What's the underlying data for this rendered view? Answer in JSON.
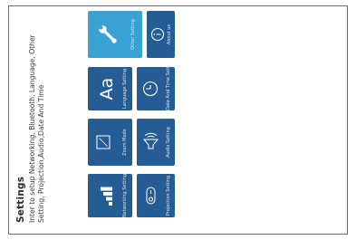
{
  "header": {
    "title": "Settings",
    "description_line1": "Inter to setup Networking, Bluetooth, Language, Other",
    "description_line2": "Setting, Projection,Audio,Date And Time"
  },
  "tiles": [
    {
      "label": "Networking Setting",
      "icon": "signal-bars-icon",
      "active": false
    },
    {
      "label": "Zoom Mode",
      "icon": "zoom-frame-icon",
      "active": false
    },
    {
      "label": "Language Setting",
      "icon": "language-aa-icon",
      "active": false
    },
    {
      "label": "Other Setting",
      "icon": "wrench-icon",
      "active": true
    },
    {
      "label": "Projection Setting",
      "icon": "projector-icon",
      "active": false
    },
    {
      "label": "Audio Setting",
      "icon": "speaker-icon",
      "active": false
    },
    {
      "label": "Date And Time Setting",
      "icon": "clock-icon",
      "active": false
    },
    {
      "label": "About us",
      "icon": "info-icon",
      "active": false
    }
  ],
  "colors": {
    "tile": "#255c94",
    "tile_active": "#3aa2d2",
    "background": "#ffffff"
  }
}
